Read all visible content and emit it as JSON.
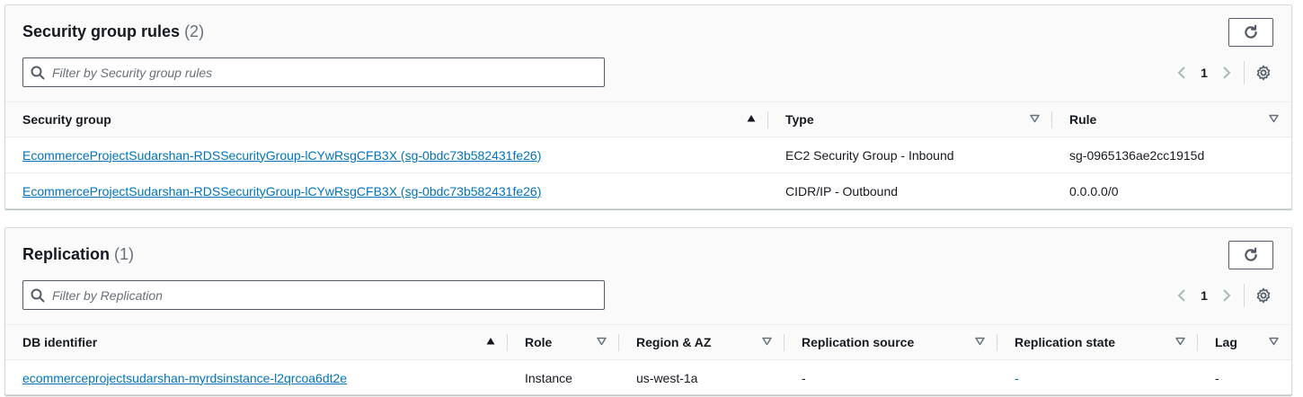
{
  "security_group_rules": {
    "title": "Security group rules",
    "count": "(2)",
    "filter_placeholder": "Filter by Security group rules",
    "page": "1",
    "columns": [
      "Security group",
      "Type",
      "Rule"
    ],
    "rows": [
      {
        "security_group": "EcommerceProjectSudarshan-RDSSecurityGroup-lCYwRsgCFB3X (sg-0bdc73b582431fe26)",
        "type": "EC2 Security Group - Inbound",
        "rule": "sg-0965136ae2cc1915d"
      },
      {
        "security_group": "EcommerceProjectSudarshan-RDSSecurityGroup-lCYwRsgCFB3X (sg-0bdc73b582431fe26)",
        "type": "CIDR/IP - Outbound",
        "rule": "0.0.0.0/0"
      }
    ]
  },
  "replication": {
    "title": "Replication",
    "count": "(1)",
    "filter_placeholder": "Filter by Replication",
    "page": "1",
    "columns": [
      "DB identifier",
      "Role",
      "Region & AZ",
      "Replication source",
      "Replication state",
      "Lag"
    ],
    "rows": [
      {
        "db_identifier": "ecommerceprojectsudarshan-myrdsinstance-l2qrcoa6dt2e",
        "role": "Instance",
        "region_az": "us-west-1a",
        "replication_source": "-",
        "replication_state": "-",
        "lag": "-"
      }
    ]
  },
  "icons": {
    "refresh": "refresh-icon",
    "search": "search-icon",
    "prev": "chevron-left-icon",
    "next": "chevron-right-icon",
    "settings": "gear-icon",
    "sort_asc": "sort-ascending-icon",
    "sort_none": "sort-unsorted-icon"
  },
  "colors": {
    "link": "#0073bb",
    "header_bg": "#fafafa",
    "border": "#d5dbdb",
    "text": "#16191f",
    "muted": "#687078"
  }
}
